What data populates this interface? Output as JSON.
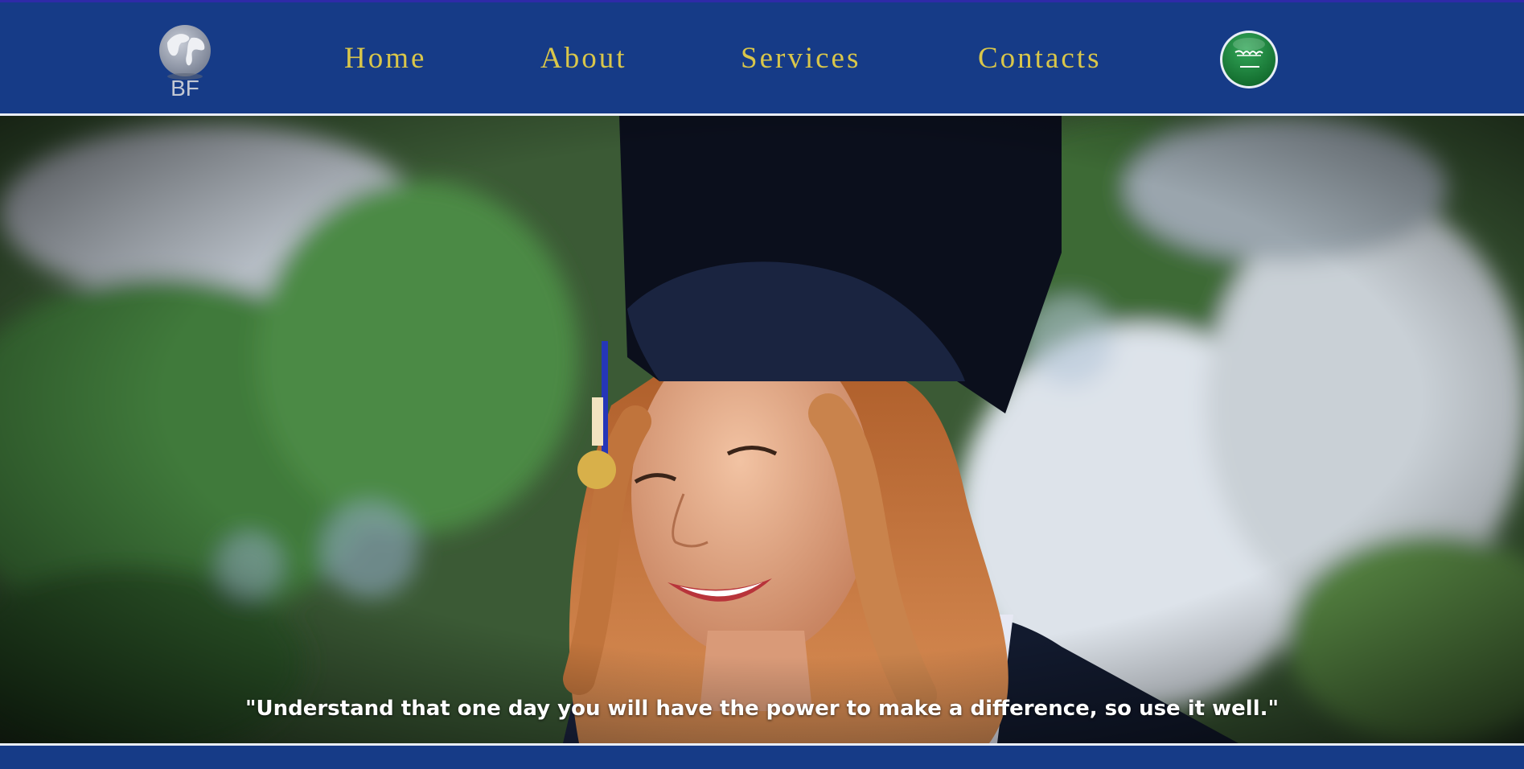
{
  "brand": {
    "logo_text": "BF",
    "logo_icon": "globe-icon"
  },
  "nav": {
    "items": [
      {
        "label": "Home"
      },
      {
        "label": "About"
      },
      {
        "label": "Services"
      },
      {
        "label": "Contacts"
      }
    ],
    "language_toggle": {
      "icon": "saudi-flag-icon"
    }
  },
  "hero": {
    "quote": "\"Understand that one day you will have the power to make a difference, so use it well.\""
  },
  "colors": {
    "navbar_bg": "#163b87",
    "nav_text": "#d9c64a",
    "quote_text": "#ffffff",
    "flag_green": "#1c8a3e"
  }
}
